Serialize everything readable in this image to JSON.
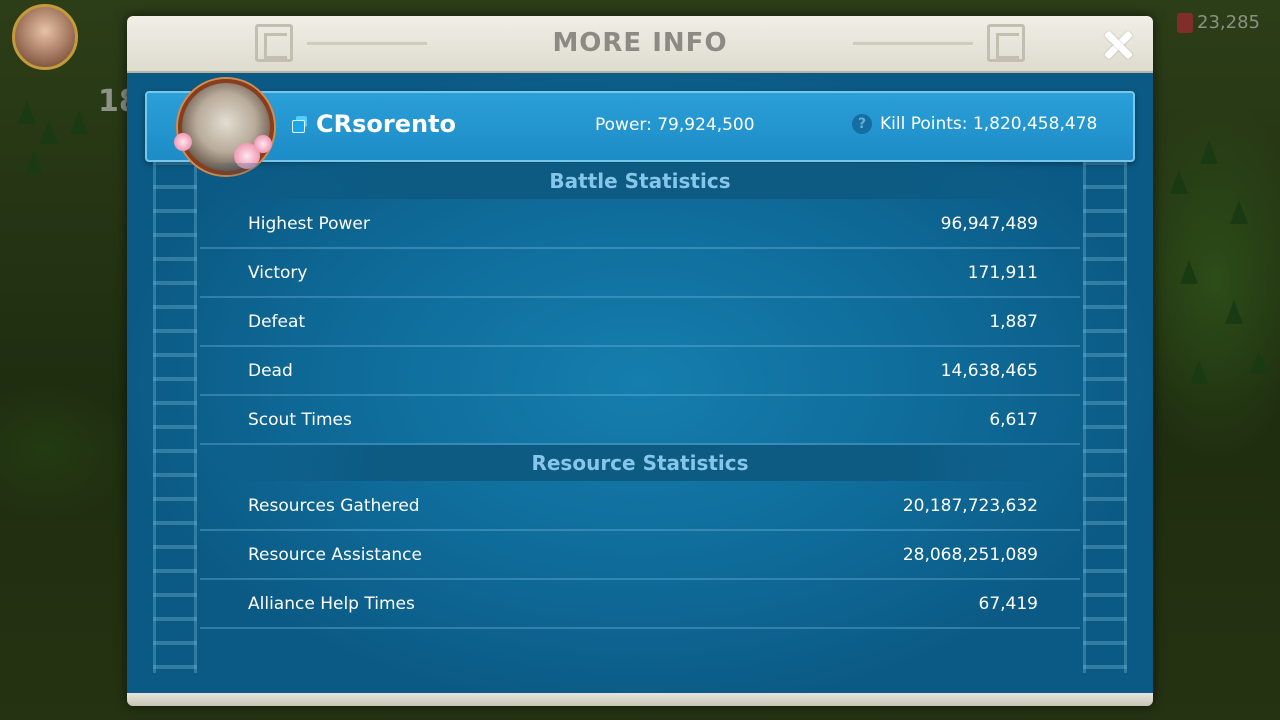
{
  "hud": {
    "level": "18",
    "gems": "23,285"
  },
  "modal": {
    "title": "MORE INFO"
  },
  "player": {
    "name": "CRsorento",
    "power": "Power: 79,924,500",
    "kill_points": "Kill Points: 1,820,458,478"
  },
  "battle_statistics": {
    "title": "Battle Statistics",
    "rows": [
      {
        "label": "Highest Power",
        "value": "96,947,489"
      },
      {
        "label": "Victory",
        "value": "171,911"
      },
      {
        "label": "Defeat",
        "value": "1,887"
      },
      {
        "label": "Dead",
        "value": "14,638,465"
      },
      {
        "label": "Scout Times",
        "value": "6,617"
      }
    ]
  },
  "resource_statistics": {
    "title": "Resource Statistics",
    "rows": [
      {
        "label": "Resources Gathered",
        "value": "20,187,723,632"
      },
      {
        "label": "Resource Assistance",
        "value": "28,068,251,089"
      },
      {
        "label": "Alliance Help Times",
        "value": "67,419"
      }
    ]
  },
  "icons": {
    "close": "close-icon",
    "copy": "copy-icon",
    "help": "help-icon",
    "gem": "gem-icon"
  },
  "colors": {
    "panel_blue": "#0f6c9a",
    "banner_blue": "#2a9fd8",
    "section_title": "#86c6ea",
    "header_bg": "#e9e7de",
    "title_gray": "#8c8a83"
  }
}
